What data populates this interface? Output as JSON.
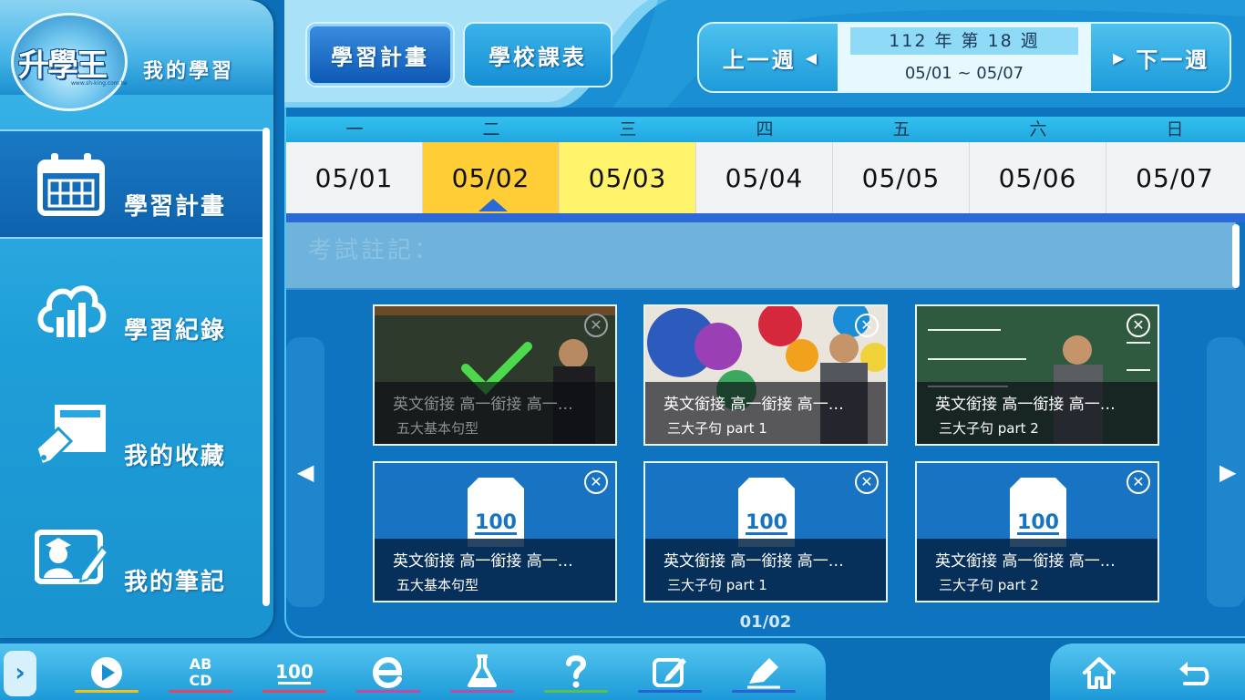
{
  "brand": {
    "logo_text": "升學王",
    "logo_url": "www.sh-king.com.tw",
    "sidebar_title": "我的學習"
  },
  "sidebar": {
    "items": [
      {
        "label": "學習計畫",
        "icon": "calendar-icon",
        "active": true
      },
      {
        "label": "學習紀錄",
        "icon": "cloud-chart-icon",
        "active": false
      },
      {
        "label": "我的收藏",
        "icon": "bookmark-book-icon",
        "active": false
      },
      {
        "label": "我的筆記",
        "icon": "student-notes-icon",
        "active": false
      }
    ]
  },
  "header": {
    "tabs": [
      {
        "label": "學習計畫",
        "active": true
      },
      {
        "label": "學校課表",
        "active": false
      }
    ],
    "prev_week": "上一週",
    "next_week": "下一週",
    "week_label": "112 年 第 18 週",
    "week_range": "05/01 ~ 05/07"
  },
  "calendar": {
    "weekdays": [
      "一",
      "二",
      "三",
      "四",
      "五",
      "六",
      "日"
    ],
    "dates": [
      "05/01",
      "05/02",
      "05/03",
      "05/04",
      "05/05",
      "05/06",
      "05/07"
    ],
    "selected_index": 1,
    "today_index": 2
  },
  "exam_note": {
    "placeholder": "考試註記："
  },
  "cards": [
    {
      "type": "video",
      "title": "英文銜接 高一銜接 高一…",
      "subtitle": "五大基本句型",
      "completed": true
    },
    {
      "type": "video",
      "title": "英文銜接 高一銜接 高一…",
      "subtitle": "三大子句 part 1",
      "completed": false
    },
    {
      "type": "video",
      "title": "英文銜接 高一銜接 高一…",
      "subtitle": "三大子句 part 2",
      "completed": false
    },
    {
      "type": "quiz",
      "title": "英文銜接 高一銜接 高一…",
      "subtitle": "五大基本句型",
      "completed": false
    },
    {
      "type": "quiz",
      "title": "英文銜接 高一銜接 高一…",
      "subtitle": "三大子句 part 1",
      "completed": false
    },
    {
      "type": "quiz",
      "title": "英文銜接 高一銜接 高一…",
      "subtitle": "三大子句 part 2",
      "completed": false
    }
  ],
  "pagination": "01/02",
  "quiz_icon_text": "100",
  "toolbar": {
    "tools": [
      {
        "name": "play-icon",
        "underline": "#f2c21b"
      },
      {
        "name": "abcd-icon",
        "underline": "#e2446a"
      },
      {
        "name": "score-100-icon",
        "underline": "#e2446a"
      },
      {
        "name": "e-icon",
        "underline": "#c24aa0"
      },
      {
        "name": "flask-icon",
        "underline": "#b64fa3"
      },
      {
        "name": "question-icon",
        "underline": "#59c24a"
      },
      {
        "name": "note-edit-icon",
        "underline": "#2a62d4"
      },
      {
        "name": "pen-icon",
        "underline": "#2a62d4"
      }
    ],
    "home_icon": "home-icon",
    "back_icon": "back-icon"
  },
  "colors": {
    "selected_day": "#ffcd36",
    "today": "#fff36c",
    "accent": "#2a69d6"
  }
}
